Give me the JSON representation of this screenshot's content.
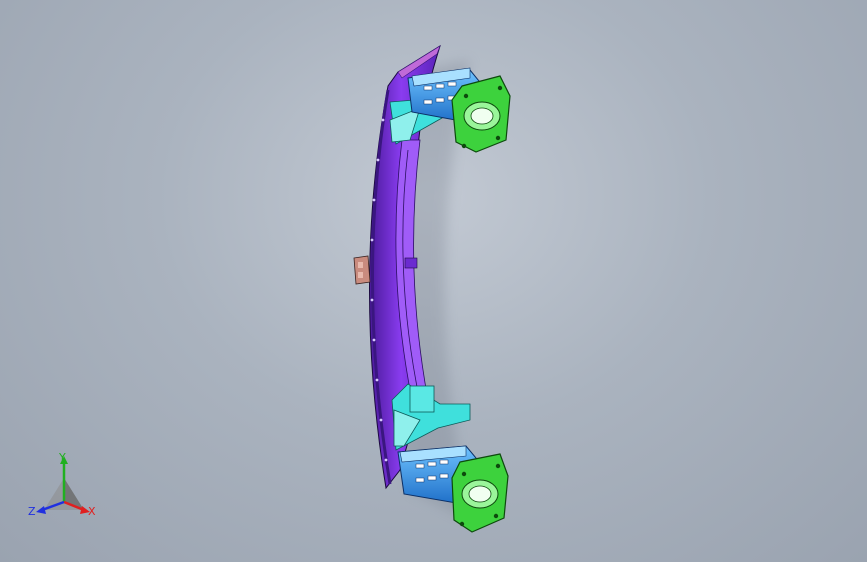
{
  "viewport": {
    "background": "#aab3bf"
  },
  "model": {
    "parts": [
      {
        "name": "bumper-beam",
        "color": "#7b2fd6"
      },
      {
        "name": "crash-box-upper",
        "color": "#2f8fe8"
      },
      {
        "name": "crash-box-lower",
        "color": "#2f8fe8"
      },
      {
        "name": "mounting-plate-upper",
        "color": "#3dd23d"
      },
      {
        "name": "mounting-plate-lower",
        "color": "#3dd23d"
      },
      {
        "name": "bracket-upper",
        "color": "#3fe0dc"
      },
      {
        "name": "bracket-lower",
        "color": "#3fe0dc"
      },
      {
        "name": "tow-hook-plate",
        "color": "#c98b7e"
      }
    ]
  },
  "triad": {
    "y_label": "Y",
    "z_label": "Z",
    "x_label": "X",
    "colors": {
      "x": "#e02020",
      "y": "#20b020",
      "z": "#2030e0"
    }
  }
}
